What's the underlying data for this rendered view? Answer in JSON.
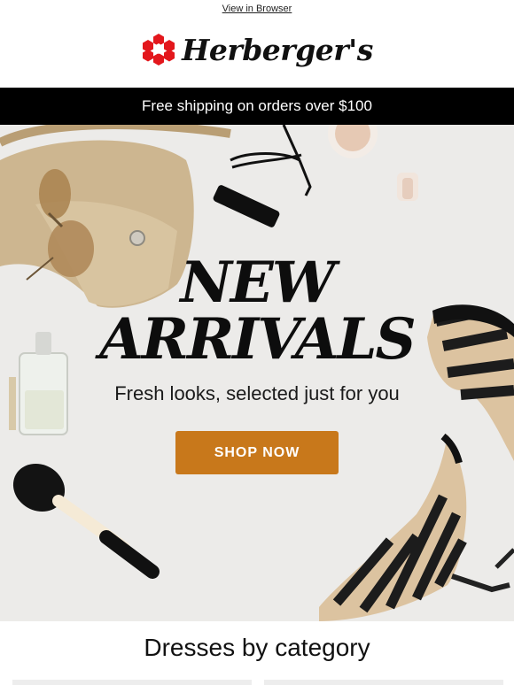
{
  "header": {
    "view_in_browser": "View in Browser",
    "brand_name": "Herberger's",
    "logo_icon": "red-flower-logo-icon"
  },
  "promo": {
    "text": "Free shipping on orders over $100"
  },
  "hero": {
    "headline_line1": "NEW",
    "headline_line2": "ARRIVALS",
    "subheadline": "Fresh looks, selected just for you",
    "cta_label": "SHOP NOW",
    "cta_color": "#c8781b"
  },
  "sections": {
    "dresses_title": "Dresses by category"
  },
  "colors": {
    "brand_red": "#e3171c",
    "promo_bg": "#000000",
    "hero_bg": "#ecebe9"
  }
}
